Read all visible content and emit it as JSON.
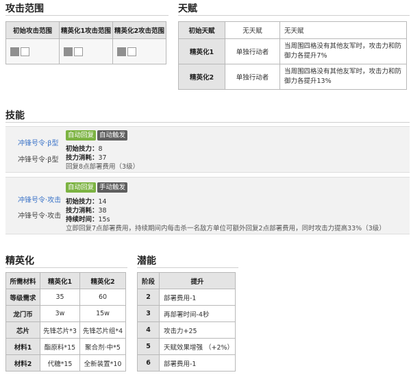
{
  "range": {
    "title": "攻击范围",
    "headers": [
      "初始攻击范围",
      "精英化1攻击范围",
      "精英化2攻击范围"
    ]
  },
  "talent": {
    "title": "天赋",
    "rows": [
      {
        "stage": "初始天赋",
        "condition": "无天赋",
        "effect": "无天赋"
      },
      {
        "stage": "精英化1",
        "condition": "单独行动者",
        "effect": "当周围四格没有其他友军时，攻击力和防御力各提升7%"
      },
      {
        "stage": "精英化2",
        "condition": "单独行动者",
        "effect": "当周围四格没有其他友军时，攻击力和防御力各提升13%"
      }
    ]
  },
  "skills": {
    "title": "技能",
    "items": [
      {
        "name_link": "冲锋号令·β型",
        "name_plain": "冲锋号令·β型",
        "badge1": "自动回复",
        "badge2": "自动触发",
        "lines": [
          {
            "label": "初始技力：",
            "value": "8"
          },
          {
            "label": "技力消耗：",
            "value": "37"
          }
        ],
        "desc": "回复8点部署费用（3级）"
      },
      {
        "name_link": "冲锋号令·攻击",
        "name_plain": "冲锋号令·攻击",
        "badge1": "自动回复",
        "badge2": "手动触发",
        "lines": [
          {
            "label": "初始技力：",
            "value": "14"
          },
          {
            "label": "技力消耗：",
            "value": "38"
          },
          {
            "label": "持续时间：",
            "value": "15s"
          }
        ],
        "desc": "立即回复7点部署费用，持续期间内每击杀一名敌方单位可额外回复2点部署费用，同时攻击力提高33%（3级）"
      }
    ]
  },
  "elite": {
    "title": "精英化",
    "headers": [
      "所需材料",
      "精英化1",
      "精英化2"
    ],
    "rows": [
      {
        "label": "等级需求",
        "e1": "35",
        "e2": "60"
      },
      {
        "label": "龙门币",
        "e1": "3w",
        "e2": "15w"
      },
      {
        "label": "芯片",
        "e1": "先锋芯片*3",
        "e2": "先锋芯片组*4"
      },
      {
        "label": "材料1",
        "e1": "酯原料*15",
        "e2": "聚合剂·中*5"
      },
      {
        "label": "材料2",
        "e1": "代糖*15",
        "e2": "全新装置*10"
      }
    ]
  },
  "potential": {
    "title": "潜能",
    "headers": [
      "阶段",
      "提升"
    ],
    "rows": [
      {
        "stage": "2",
        "effect": "部署费用-1"
      },
      {
        "stage": "3",
        "effect": "再部署时间-4秒"
      },
      {
        "stage": "4",
        "effect": "攻击力+25"
      },
      {
        "stage": "5",
        "effect": "天赋效果增强 （+2%）"
      },
      {
        "stage": "6",
        "effect": "部署费用-1"
      }
    ]
  }
}
